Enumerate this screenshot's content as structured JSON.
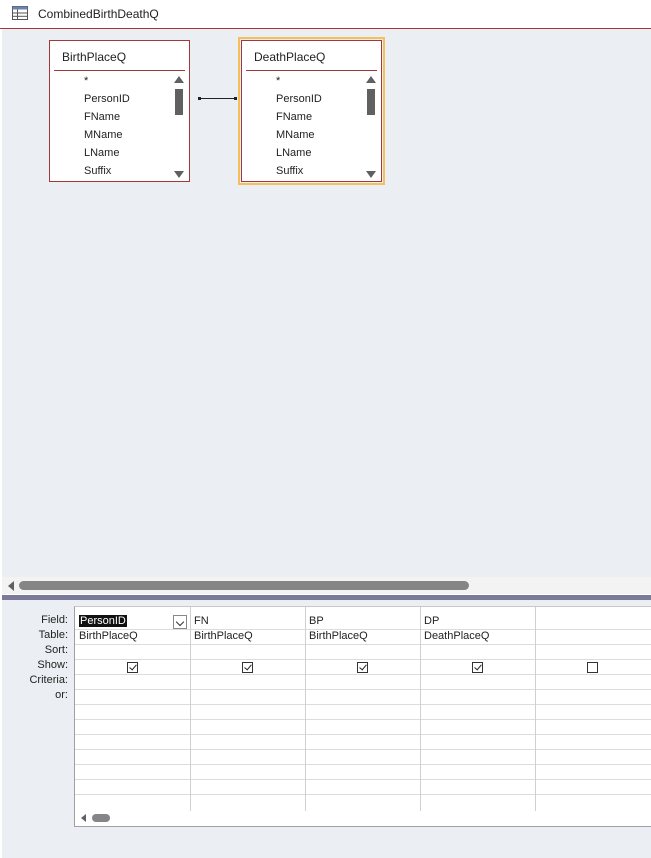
{
  "window": {
    "title": "CombinedBirthDeathQ"
  },
  "tables": [
    {
      "name": "BirthPlaceQ",
      "fields": [
        "*",
        "PersonID",
        "FName",
        "MName",
        "LName",
        "Suffix"
      ]
    },
    {
      "name": "DeathPlaceQ",
      "fields": [
        "*",
        "PersonID",
        "FName",
        "MName",
        "LName",
        "Suffix"
      ]
    }
  ],
  "grid": {
    "row_labels": [
      "Field:",
      "Table:",
      "Sort:",
      "Show:",
      "Criteria:",
      "or:"
    ],
    "columns": [
      {
        "field": "PersonID",
        "table": "BirthPlaceQ",
        "show": true
      },
      {
        "field": "FN",
        "table": "BirthPlaceQ",
        "show": true
      },
      {
        "field": "BP",
        "table": "BirthPlaceQ",
        "show": true
      },
      {
        "field": "DP",
        "table": "DeathPlaceQ",
        "show": true
      },
      {
        "field": "",
        "table": "",
        "show": false
      }
    ]
  },
  "colors": {
    "accent": "#a4373a",
    "selection_outline": "#f4c05a",
    "design_bg": "#ebeef2"
  },
  "icons": {
    "title": "query-icon",
    "dropdown": "chevron-down-icon"
  }
}
